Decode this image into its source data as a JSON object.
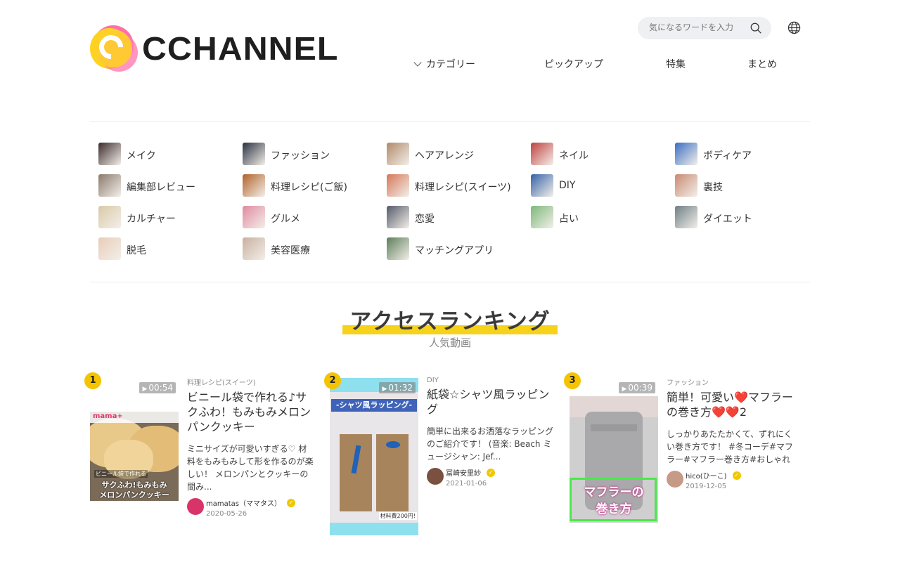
{
  "header": {
    "logo_text": "CCHANNEL",
    "search_placeholder": "気になるワードを入力",
    "nav": [
      {
        "label": "カテゴリー"
      },
      {
        "label": "ピックアップ"
      },
      {
        "label": "特集"
      },
      {
        "label": "まとめ"
      }
    ]
  },
  "categories": [
    {
      "label": "メイク",
      "color": "#3b2b2b"
    },
    {
      "label": "ファッション",
      "color": "#2a3140"
    },
    {
      "label": "ヘアアレンジ",
      "color": "#b08a6a"
    },
    {
      "label": "ネイル",
      "color": "#c0413f"
    },
    {
      "label": "ボディケア",
      "color": "#3a6fc4"
    },
    {
      "label": "編集部レビュー",
      "color": "#8a7a6c"
    },
    {
      "label": "料理レシピ(ご飯)",
      "color": "#b0632a"
    },
    {
      "label": "料理レシピ(スイーツ)",
      "color": "#d4785a"
    },
    {
      "label": "DIY",
      "color": "#3463a8"
    },
    {
      "label": "裏技",
      "color": "#c98a72"
    },
    {
      "label": "カルチャー",
      "color": "#d9c9a8"
    },
    {
      "label": "グルメ",
      "color": "#e18aa0"
    },
    {
      "label": "恋愛",
      "color": "#555a6a"
    },
    {
      "label": "占い",
      "color": "#7cb87a"
    },
    {
      "label": "ダイエット",
      "color": "#6e7f86"
    },
    {
      "label": "脱毛",
      "color": "#e8cdb8"
    },
    {
      "label": "美容医療",
      "color": "#c8b0a0"
    },
    {
      "label": "マッチングアプリ",
      "color": "#5d7e5a"
    }
  ],
  "ranking": {
    "title": "アクセスランキング",
    "subtitle": "人気動画",
    "items": [
      {
        "rank": "1",
        "duration": "00:54",
        "category": "料理レシピ(スイーツ)",
        "title": "ビニール袋で作れる♪サクふわ！もみもみメロンパンクッキー",
        "desc": "ミニサイズが可愛いすぎる♡ 材料をもみもみして形を作るのが楽しい！ メロンパンとクッキーの間み...",
        "author": "mamatas（ママタス）",
        "date": "2020-05-26",
        "avatar_color": "#d8346a",
        "thumb_caption_top": "ビニール袋で作れる",
        "thumb_caption_main": "サクふわ!もみもみ",
        "thumb_caption_main2": "メロンパンクッキー",
        "thumb_brand": "mama+"
      },
      {
        "rank": "2",
        "duration": "01:32",
        "category": "DIY",
        "title": "紙袋☆シャツ風ラッピング",
        "desc": "簡単に出来るお洒落なラッピングのご紹介です！ (音楽: Beach ミュージシャン: Jef...",
        "author": "冨崎安里紗",
        "date": "2021-01-06",
        "avatar_color": "#7a5040",
        "thumb_caption_main": "-シャツ風ラッピング-",
        "thumb_caption_bottom": "材料費200円!"
      },
      {
        "rank": "3",
        "duration": "00:39",
        "category": "ファッション",
        "title": "簡単！可愛い❤️マフラーの巻き方❤️❤️2",
        "desc": "しっかりあたたかくて、ずれにくい巻き方です！ #冬コーデ#マフラー#マフラー巻き方#おしゃれ",
        "author": "hico(ひーこ)",
        "date": "2019-12-05",
        "avatar_color": "#c79a88",
        "thumb_caption_main": "マフラーの",
        "thumb_caption_main2": "巻き方"
      }
    ]
  }
}
